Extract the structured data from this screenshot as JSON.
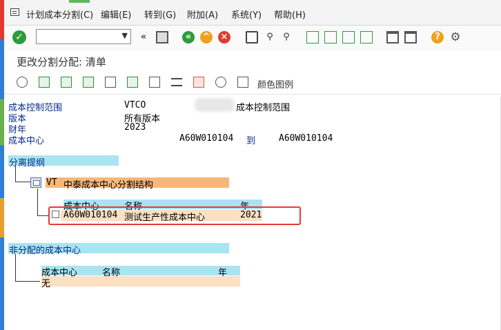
{
  "menu": {
    "items": [
      "计划成本分割(C)",
      "编辑(E)",
      "转到(G)",
      "附加(A)",
      "系统(Y)",
      "帮助(H)"
    ]
  },
  "title": "更改分割分配: 清单",
  "toolbar2": {
    "legend_label": "颜色图例"
  },
  "header": {
    "rows": [
      {
        "label": "成本控制范围",
        "value": "VTCO",
        "extra": "成本控制范围"
      },
      {
        "label": "版本",
        "value": "所有版本"
      },
      {
        "label": "财年",
        "value": "2023"
      },
      {
        "label": "成本中心",
        "from": "A60W010104",
        "to_label": "到",
        "to": "A60W010104"
      }
    ]
  },
  "assigned": {
    "section_title": "分离提纲",
    "structure_code": "VT",
    "structure_name": "中泰成本中心分割结构",
    "columns": [
      "成本中心",
      "名称",
      "年"
    ],
    "row": {
      "cost_center": "A60W010104",
      "name": "测试生产性成本中心",
      "year": "2021"
    }
  },
  "unassigned": {
    "section_title": "非分配的成本中心",
    "columns": [
      "成本中心",
      "名称",
      "年"
    ],
    "empty_text": "无"
  },
  "colors": {
    "header_cyan": "#a8e4f2",
    "row_peach": "#fbe0c4",
    "structure_orange": "#f8b77a",
    "highlight_red": "#e53935"
  }
}
